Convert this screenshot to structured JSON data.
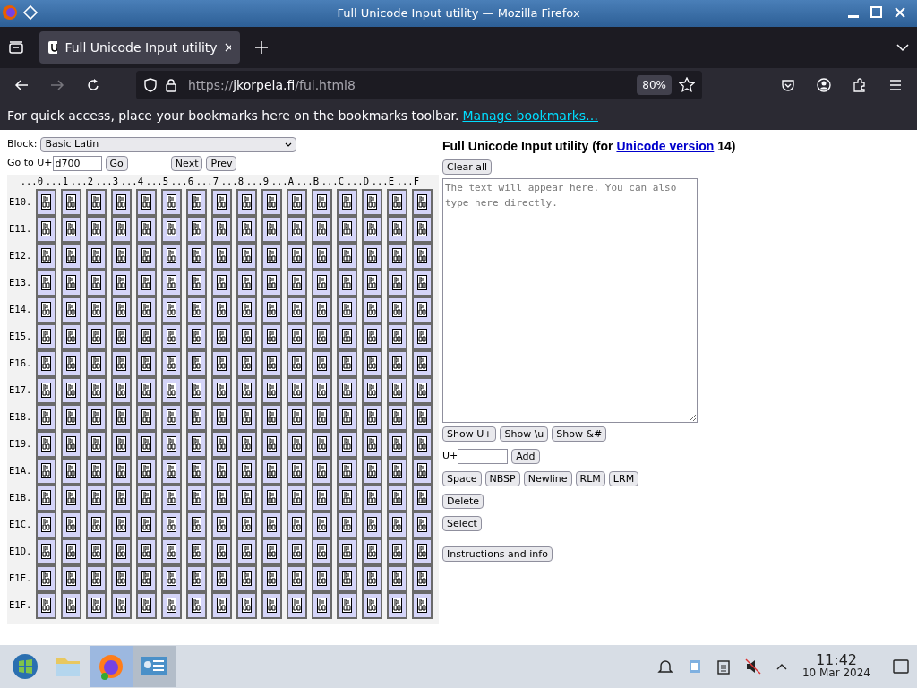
{
  "window": {
    "title": "Full Unicode Input utility — Mozilla Firefox"
  },
  "tabs": [
    {
      "label": "Full Unicode Input utility",
      "selected": true
    }
  ],
  "address_bar": {
    "url_scheme": "https://",
    "url_domain": "jkorpela.fi",
    "url_path": "/fui.html8",
    "zoom": "80%"
  },
  "bookmarks_bar": {
    "text": "For quick access, place your bookmarks here on the bookmarks toolbar.",
    "link": "Manage bookmarks…"
  },
  "picker": {
    "block_label": "Block:",
    "block_value": "Basic Latin",
    "goto_label": "Go to U+",
    "goto_value": "d700",
    "buttons": [
      "Go",
      "Next",
      "Prev"
    ],
    "columns": [
      "...0",
      "...1",
      "...2",
      "...3",
      "...4",
      "...5",
      "...6",
      "...7",
      "...8",
      "...9",
      "...A",
      "...B",
      "...C",
      "...D",
      "...E",
      "...F"
    ],
    "rows": [
      "E10.",
      "E11.",
      "E12.",
      "E13.",
      "E14.",
      "E15.",
      "E16.",
      "E17.",
      "E18.",
      "E19.",
      "E1A.",
      "E1B.",
      "E1C.",
      "E1D.",
      "E1E.",
      "E1F."
    ]
  },
  "editor": {
    "heading": "Full Unicode Input utility (for ",
    "heading_link": "Unicode version",
    "heading_end": " 14)",
    "clear_button": "Clear all",
    "placeholder": "The text will appear here. You can also type here directly.",
    "show_buttons": [
      "Show U+",
      "Show \\u",
      "Show &#"
    ],
    "add_label": "U+",
    "add_button": "Add",
    "char_buttons": [
      "Space",
      "NBSP",
      "Newline",
      "RLM",
      "LRM"
    ],
    "delete_button": "Delete",
    "select_button": "Select",
    "info_button": "Instructions and info"
  },
  "taskbar": {
    "time": "11:42",
    "date": "10 Mar 2024"
  }
}
